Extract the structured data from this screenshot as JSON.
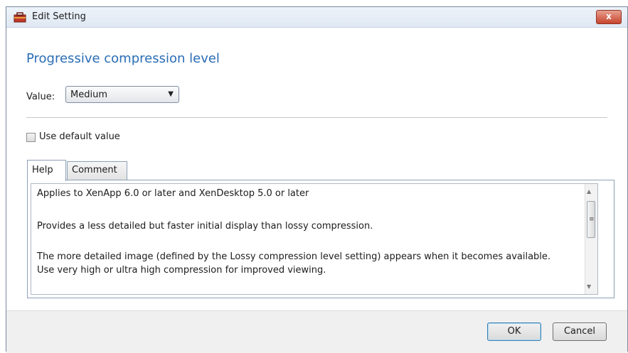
{
  "window": {
    "title": "Edit Setting",
    "close_label": "x"
  },
  "setting": {
    "heading": "Progressive compression level",
    "value_label": "Value:",
    "value_selected": "Medium"
  },
  "default_checkbox": {
    "label": "Use default value",
    "checked": false
  },
  "tabs": [
    {
      "label": "Help",
      "active": true
    },
    {
      "label": "Comment",
      "active": false
    }
  ],
  "help": {
    "paragraphs": [
      "Applies to XenApp 6.0 or later and XenDesktop 5.0 or later",
      "Provides a less detailed but faster initial display than lossy compression.",
      "The more detailed image (defined by the Lossy compression level setting) appears when it becomes available.",
      "Use very high or ultra high compression for improved viewing."
    ]
  },
  "buttons": {
    "ok": "OK",
    "cancel": "Cancel"
  },
  "colors": {
    "heading": "#2a6db5",
    "close_button": "#c7442d"
  }
}
